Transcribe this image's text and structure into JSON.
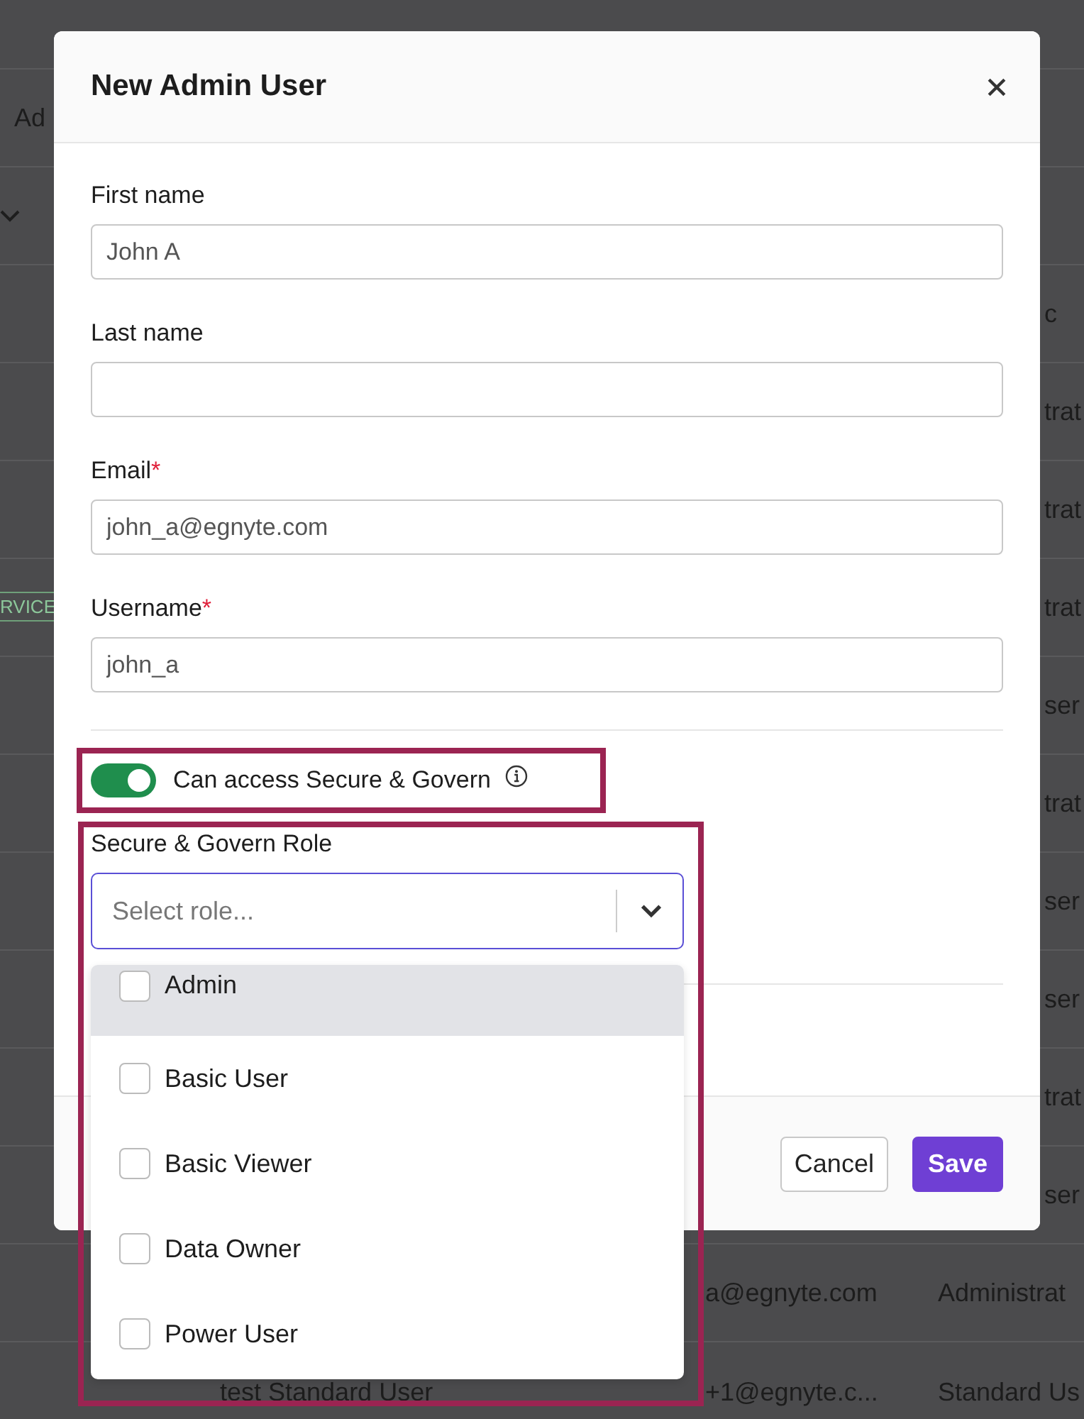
{
  "background_table": {
    "rows": [
      {
        "kind": "text",
        "column_1": "Ad"
      },
      {
        "kind": "chevron"
      },
      {
        "kind": "text",
        "column_5": "c"
      },
      {
        "kind": "text",
        "column_5": "trat"
      },
      {
        "kind": "text",
        "column_5": "trat"
      },
      {
        "kind": "badge",
        "column_1": "RVICE",
        "column_5": "trat"
      },
      {
        "kind": "text",
        "column_5": "ser"
      },
      {
        "kind": "text",
        "column_5": "trat"
      },
      {
        "kind": "text",
        "column_5": "ser"
      },
      {
        "kind": "text",
        "column_5": "ser"
      },
      {
        "kind": "text",
        "column_5": "trat"
      },
      {
        "kind": "text",
        "column_5": "ser"
      },
      {
        "kind": "text",
        "column_3": "a@egnyte.com",
        "column_4": "Administrat"
      },
      {
        "kind": "text",
        "column_2": "test Standard User",
        "column_3": "+1@egnyte.c...",
        "column_4": "Standard Us"
      }
    ]
  },
  "dialog": {
    "title": "New Admin User",
    "fields": [
      {
        "label": "First name",
        "value": "John A"
      },
      {
        "label": "Last name"
      },
      {
        "label": "Email",
        "required_mark": "*",
        "value": "john_a@egnyte.com"
      },
      {
        "label": "Username",
        "required_mark": "*",
        "value": "john_a"
      }
    ],
    "toggle": {
      "label": "Can access Secure & Govern",
      "on": true
    },
    "role": {
      "label": "Secure & Govern Role",
      "placeholder": "Select role...",
      "expanded": true,
      "options": [
        {
          "label": "Admin",
          "checked": false,
          "highlighted": true
        },
        {
          "label": "Basic User",
          "checked": false,
          "highlighted": false
        },
        {
          "label": "Basic Viewer",
          "checked": false,
          "highlighted": false
        },
        {
          "label": "Data Owner",
          "checked": false,
          "highlighted": false
        },
        {
          "label": "Power User",
          "checked": false,
          "highlighted": false
        }
      ]
    },
    "buttons": [
      {
        "label": "Cancel",
        "kind": "secondary"
      },
      {
        "label": "Save",
        "kind": "primary"
      }
    ]
  }
}
